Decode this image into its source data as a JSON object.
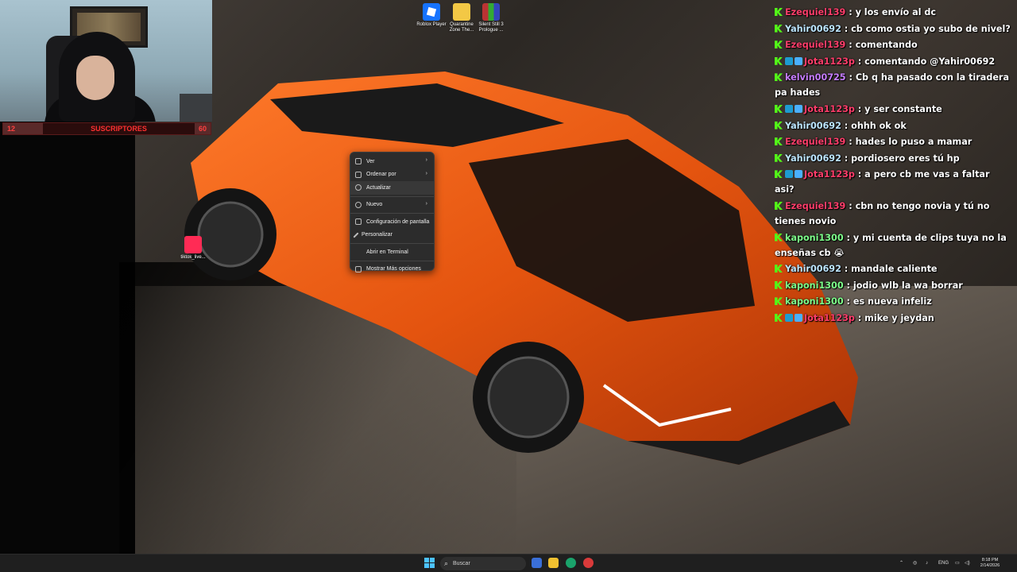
{
  "webcam": {
    "subscriber_bar": {
      "left_value": "12",
      "label": "SUSCRIPTORES",
      "right_value": "60"
    }
  },
  "desktop_icons": [
    {
      "label": "Roblox Player",
      "icon": "roblox-icon"
    },
    {
      "label": "Quarantine Zone The...",
      "icon": "folder-icon"
    },
    {
      "label": "Silent Still 3 Prologue ...",
      "icon": "winrar-icon"
    },
    {
      "label": "tiktok_live...",
      "icon": "tiktok-icon"
    }
  ],
  "context_menu": {
    "items": [
      {
        "label": "Ver",
        "icon": "grid-icon",
        "submenu": true
      },
      {
        "label": "Ordenar por",
        "icon": "sort-icon",
        "submenu": true
      },
      {
        "label": "Actualizar",
        "icon": "refresh-icon",
        "submenu": false
      },
      {
        "label": "Nuevo",
        "icon": "plus-icon",
        "submenu": true
      },
      {
        "label": "Configuración de pantalla",
        "icon": "display-icon",
        "submenu": false
      },
      {
        "label": "Personalizar",
        "icon": "brush-icon",
        "submenu": false
      },
      {
        "label": "Abrir en Terminal",
        "icon": "terminal-icon",
        "submenu": false
      },
      {
        "label": "Mostrar Más opciones",
        "icon": "more-options-icon",
        "submenu": false
      }
    ],
    "submenu_arrow": "›"
  },
  "chat": {
    "messages": [
      {
        "user": "Ezequiel139",
        "color": "#ff3d6a",
        "badges": 0,
        "text": "y los envío al dc"
      },
      {
        "user": "Yahir00692",
        "color": "#bde6ff",
        "badges": 0,
        "text": "cb como ostia yo subo de nivel?"
      },
      {
        "user": "Ezequiel139",
        "color": "#ff3d6a",
        "badges": 0,
        "text": "comentando"
      },
      {
        "user": "Jota1123p",
        "color": "#ff3d6a",
        "badges": 2,
        "text": "comentando @Yahir00692"
      },
      {
        "user": "kelvin00725",
        "color": "#c77dff",
        "badges": 0,
        "text": "Cb q ha pasado con la tiradera pa hades"
      },
      {
        "user": "Jota1123p",
        "color": "#ff3d6a",
        "badges": 2,
        "text": "y ser constante"
      },
      {
        "user": "Yahir00692",
        "color": "#bde6ff",
        "badges": 0,
        "text": "ohhh ok ok"
      },
      {
        "user": "Ezequiel139",
        "color": "#ff3d6a",
        "badges": 0,
        "text": "hades lo puso a mamar"
      },
      {
        "user": "Yahir00692",
        "color": "#bde6ff",
        "badges": 0,
        "text": "pordiosero eres tú hp"
      },
      {
        "user": "Jota1123p",
        "color": "#ff3d6a",
        "badges": 2,
        "text": "a pero cb me vas a faltar asi?"
      },
      {
        "user": "Ezequiel139",
        "color": "#ff3d6a",
        "badges": 0,
        "text": "cbn no tengo novia y tú no tienes novio"
      },
      {
        "user": "kaponi1300",
        "color": "#7dff8a",
        "badges": 0,
        "text": "y mi cuenta de clips tuya no la enseñas cb 😭"
      },
      {
        "user": "Yahir00692",
        "color": "#bde6ff",
        "badges": 0,
        "text": "mandale caliente"
      },
      {
        "user": "kaponi1300",
        "color": "#7dff8a",
        "badges": 0,
        "text": "jodio wlb la wa borrar"
      },
      {
        "user": "kaponi1300",
        "color": "#7dff8a",
        "badges": 0,
        "text": "es nueva infeliz"
      },
      {
        "user": "Jota1123p",
        "color": "#ff3d6a",
        "badges": 2,
        "text": "mike y jeydan"
      }
    ]
  },
  "taskbar": {
    "search_label": "Buscar",
    "tray_language": "ENG",
    "clock_time": "8:18 PM",
    "clock_date": "2/14/2026"
  },
  "colors": {
    "accent": "#4cc2ff",
    "kick_green": "#53fc18",
    "subbar_red": "#ff3030"
  }
}
